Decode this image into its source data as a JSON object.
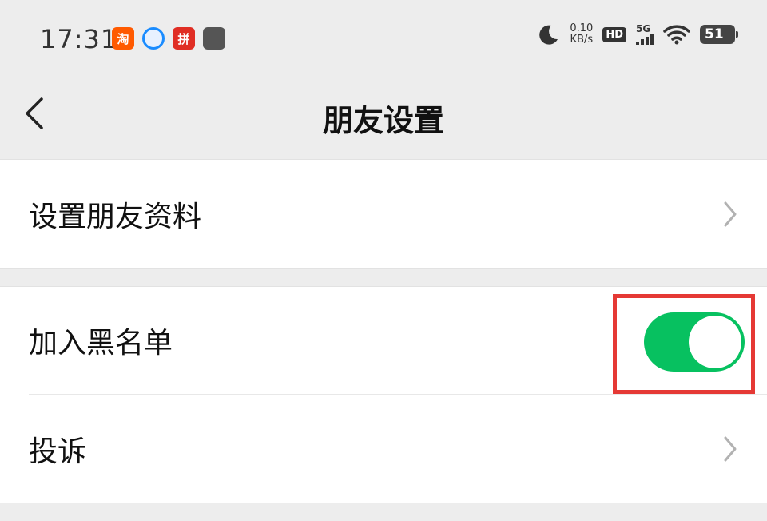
{
  "status_bar": {
    "time": "17:31",
    "app_icons": [
      {
        "name": "taobao-app-icon",
        "glyph": "淘"
      },
      {
        "name": "browser-app-icon",
        "glyph": ""
      },
      {
        "name": "pinduoduo-app-icon",
        "glyph": "拼"
      },
      {
        "name": "app-icon",
        "glyph": ""
      }
    ],
    "net_speed_value": "0.10",
    "net_speed_unit": "KB/s",
    "hd_label": "HD",
    "signal_label": "5G",
    "battery_level": "51"
  },
  "nav": {
    "title": "朋友设置"
  },
  "settings": {
    "friend_profile_label": "设置朋友资料",
    "blacklist_label": "加入黑名单",
    "blacklist_enabled": true,
    "complain_label": "投诉"
  },
  "colors": {
    "toggle_on": "#07c160",
    "highlight_border": "#e53935",
    "background": "#ededed"
  }
}
